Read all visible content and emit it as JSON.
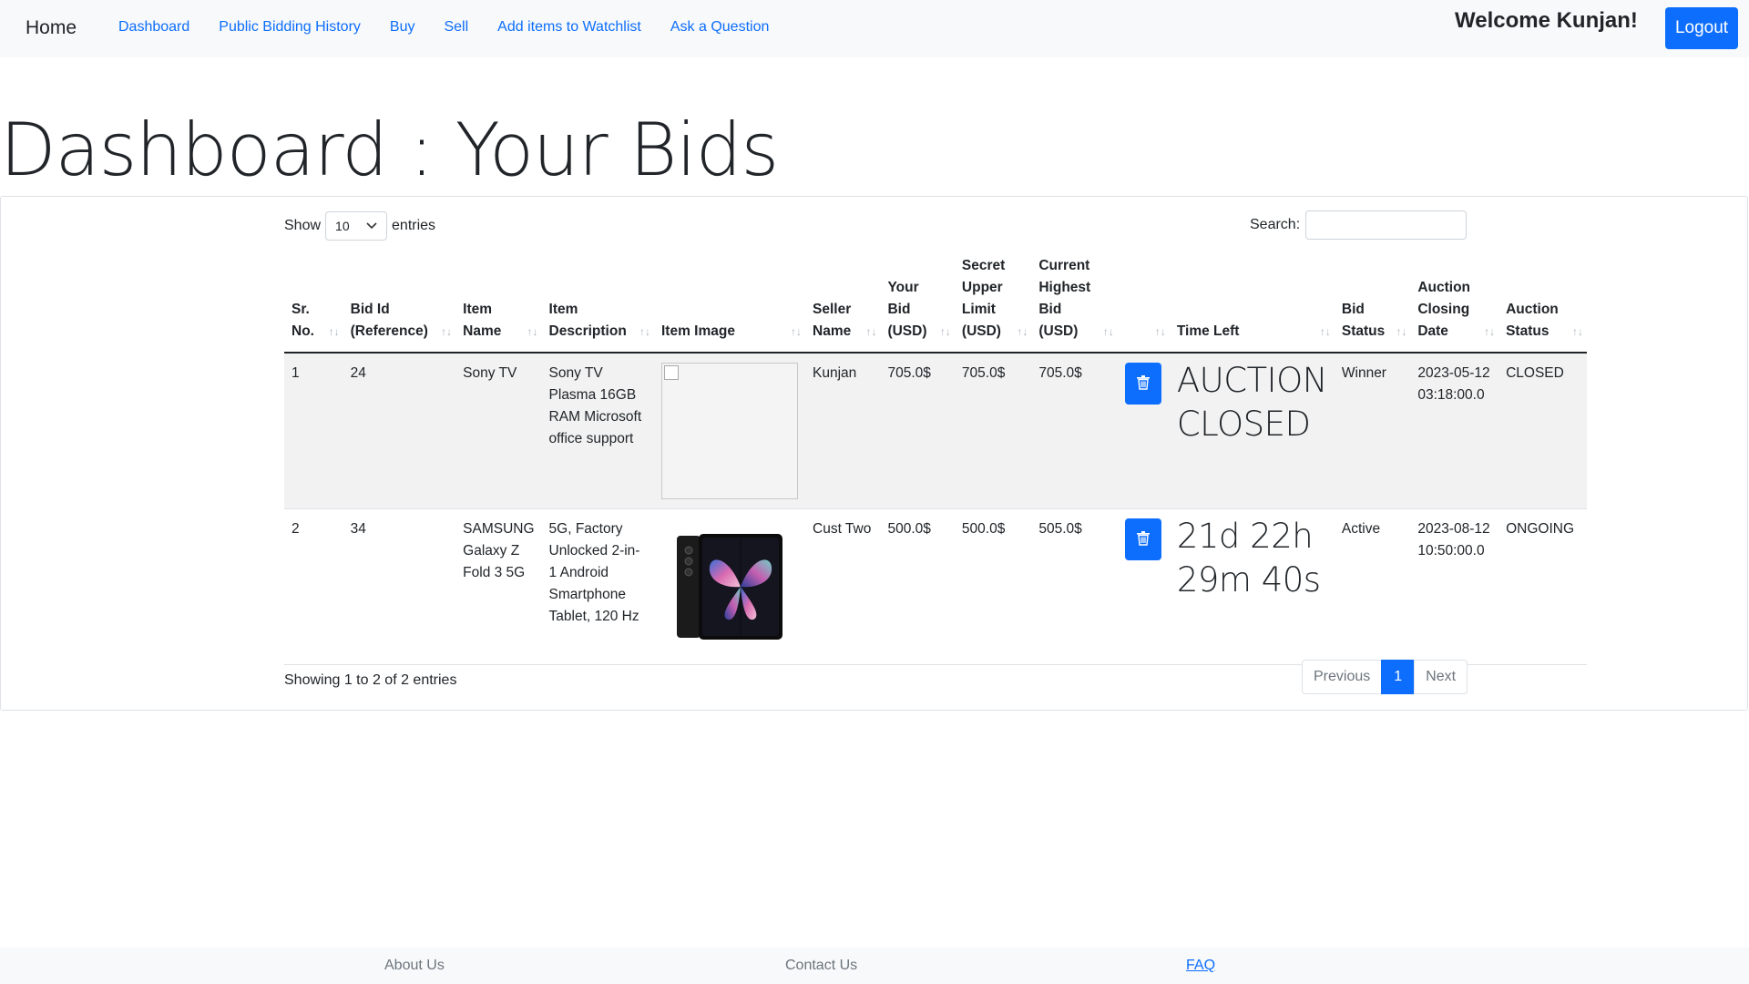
{
  "navbar": {
    "brand": "Home",
    "links": [
      "Dashboard",
      "Public Bidding History",
      "Buy",
      "Sell",
      "Add items to Watchlist",
      "Ask a Question"
    ],
    "welcome": "Welcome Kunjan!",
    "logout_label": "Logout"
  },
  "page": {
    "title": "Dashboard : Your Bids"
  },
  "controls": {
    "show_label": "Show",
    "entries_label": "entries",
    "page_length": "10",
    "search_label": "Search:",
    "search_value": ""
  },
  "table": {
    "columns": [
      "Sr. No.",
      "Bid Id (Reference)",
      "Item Name",
      "Item Description",
      "Item Image",
      "Seller Name",
      "Your Bid (USD)",
      "Secret Upper Limit (USD)",
      "Current Highest Bid (USD)",
      "",
      "Time Left",
      "Bid Status",
      "Auction Closing Date",
      "Auction Status"
    ],
    "rows": [
      {
        "sr": "1",
        "bid_id": "24",
        "item_name": "Sony TV",
        "description": "Sony TV Plasma 16GB RAM Microsoft office support",
        "seller": "Kunjan",
        "your_bid": "705.0$",
        "upper_limit": "705.0$",
        "highest_bid": "705.0$",
        "time_left": "AUCTION CLOSED",
        "bid_status": "Winner",
        "closing_date": "2023-05-12 03:18:00.0",
        "auction_status": "CLOSED"
      },
      {
        "sr": "2",
        "bid_id": "34",
        "item_name": "SAMSUNG Galaxy Z Fold 3 5G",
        "description": "5G, Factory Unlocked 2-in-1 Android Smartphone Tablet, 120 Hz",
        "seller": "Cust Two",
        "your_bid": "500.0$",
        "upper_limit": "500.0$",
        "highest_bid": "505.0$",
        "time_left": "21d 22h 29m 40s",
        "bid_status": "Active",
        "closing_date": "2023-08-12 10:50:00.0",
        "auction_status": "ONGOING"
      }
    ]
  },
  "footer_info": "Showing 1 to 2 of 2 entries",
  "pagination": {
    "previous": "Previous",
    "current": "1",
    "next": "Next"
  },
  "page_footer": {
    "about": "About Us",
    "contact": "Contact Us",
    "faq": "FAQ"
  },
  "icons": {
    "delete": "trash-icon",
    "sort": "sort-arrows-icon",
    "select": "chevron-down-icon"
  },
  "colors": {
    "primary": "#0d6efd",
    "navbar_bg": "#f8f9fa",
    "striped_row": "#f2f2f2"
  }
}
